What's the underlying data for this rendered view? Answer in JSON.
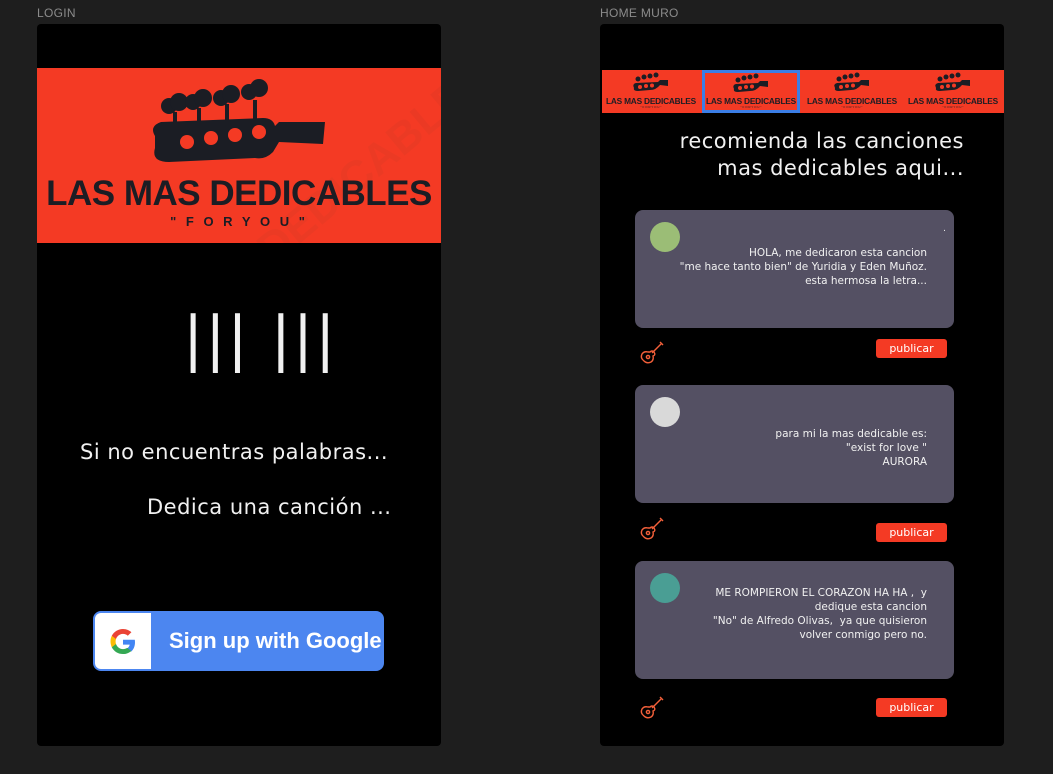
{
  "frames": {
    "login_label": "LOGIN",
    "home_label": "HOME MURO"
  },
  "brand": {
    "title": "LAS MAS DEDICABLES",
    "subtitle": "\" F O R   Y O U \"",
    "mini_subtitle": "\" F O R   Y O U \""
  },
  "login": {
    "pause_symbol": "||| |||",
    "line1": "Si no encuentras palabras...",
    "line2": "Dedica una canción ...",
    "google_button": "Sign up with Google"
  },
  "home": {
    "nav_tabs": [
      {
        "label": "LAS MAS DEDICABLES",
        "active": false
      },
      {
        "label": "LAS MAS DEDICABLES",
        "active": true
      },
      {
        "label": "LAS MAS DEDICABLES",
        "active": false
      },
      {
        "label": "LAS MAS DEDICABLES",
        "active": false
      }
    ],
    "headline_line1": "recomienda las canciones",
    "headline_line2": "mas dedicables aqui...",
    "posts": [
      {
        "avatar_color": "#9bbd76",
        "dot": ".",
        "text": "HOLA, me dedicaron esta cancion\n\"me hace tanto bien\" de Yuridia y Eden Muñoz.\nesta hermosa la letra...",
        "button": "publicar"
      },
      {
        "avatar_color": "#d9d9d9",
        "dot": "",
        "text": "para mi la mas dedicable es:\n\"exist for love \"\nAURORA",
        "button": "publicar"
      },
      {
        "avatar_color": "#4a9e94",
        "dot": "",
        "text": "ME ROMPIERON EL CORAZON HA HA ,  y\ndedique esta cancion\n\"No\" de Alfredo Olivas,  ya que quisieron\nvolver conmigo pero no.",
        "button": "publicar"
      }
    ]
  },
  "colors": {
    "accent": "#f43a24",
    "card": "#545063",
    "google_blue": "#4c86f0",
    "active_tab_border": "#3b7ee6"
  },
  "icons": {
    "guitar": "guitar-icon",
    "google": "google-logo-icon",
    "headstock": "guitar-headstock-logo"
  }
}
